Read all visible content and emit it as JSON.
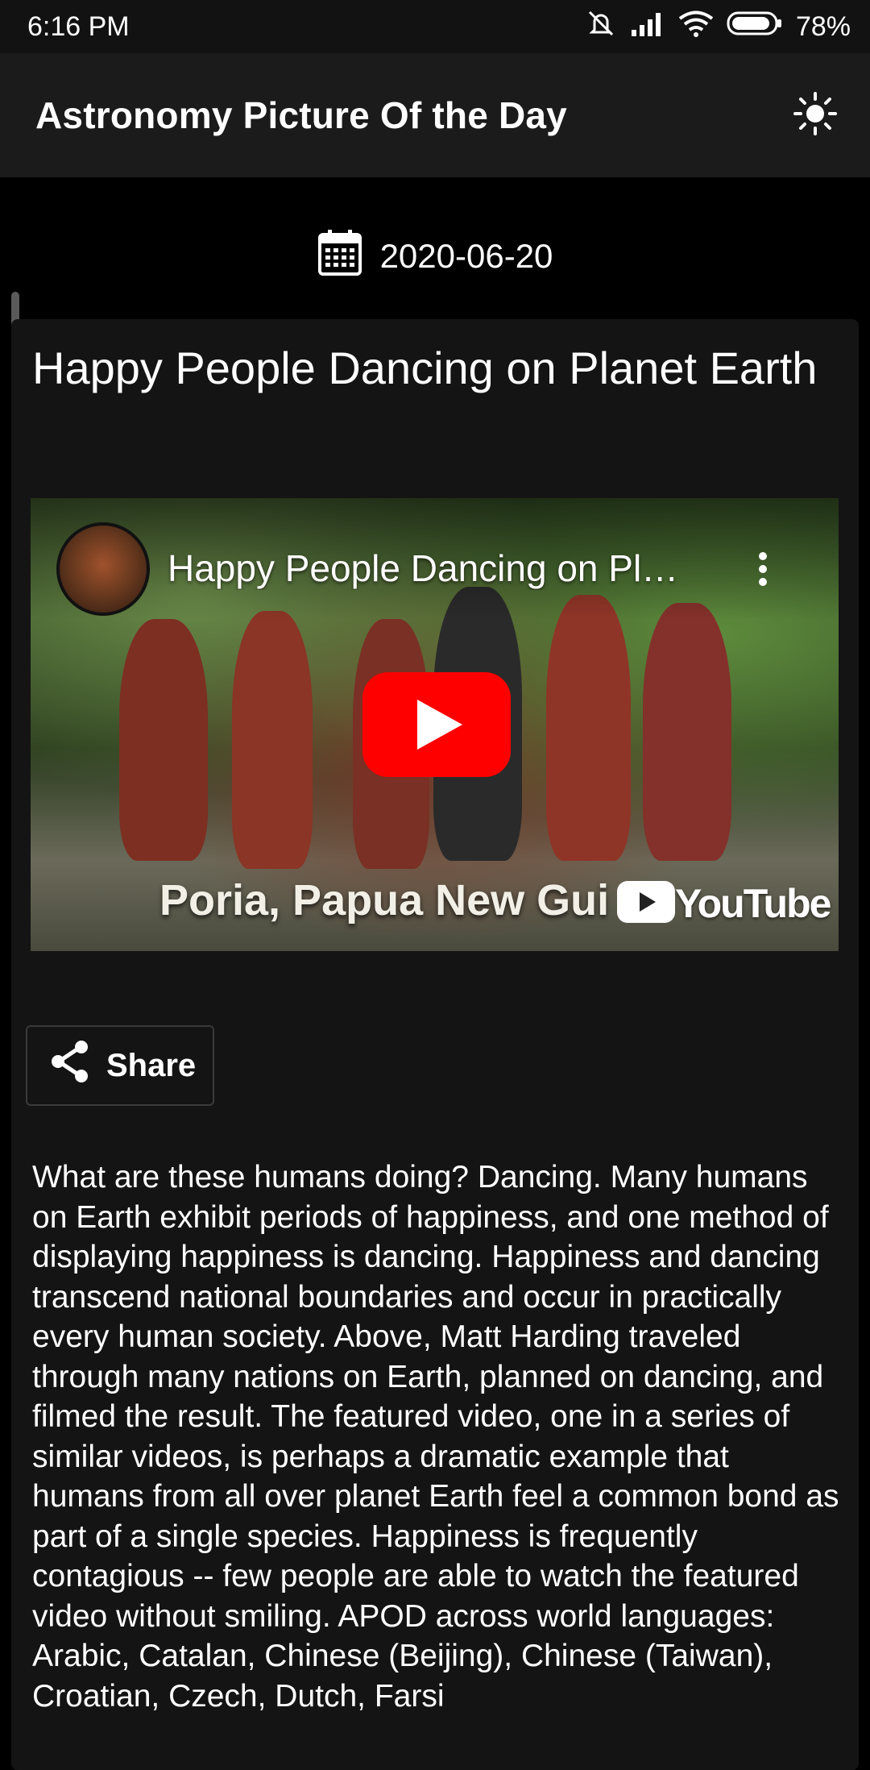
{
  "status_bar": {
    "time": "6:16 PM",
    "battery": "78%",
    "icons": [
      "mute-icon",
      "signal-icon",
      "wifi-icon",
      "battery-icon"
    ]
  },
  "app_bar": {
    "title": "Astronomy Picture Of the Day",
    "theme_toggle_icon": "sun-icon"
  },
  "date": {
    "icon": "calendar-icon",
    "value": "2020-06-20"
  },
  "post": {
    "title": "Happy People Dancing on Planet Earth",
    "video": {
      "title": "Happy People Dancing on Pl…",
      "caption": "Poria, Papua New Gui",
      "provider": "YouTube",
      "play_icon": "youtube-play-icon",
      "menu_icon": "more-vertical-icon"
    },
    "share_label": "Share",
    "description": "What are these humans doing?  Dancing.  Many humans on Earth exhibit periods of happiness, and one method of displaying happiness is dancing. Happiness and dancing transcend national boundaries and occur in practically every human society. Above, Matt Harding traveled through many nations on Earth, planned on dancing, and filmed the result.  The featured video, one in a series of similar videos, is perhaps a dramatic example that humans from all over planet Earth feel a common bond as part of a single species. Happiness is frequently contagious -- few people are able to watch the featured video without smiling.   APOD across world languages: Arabic, Catalan, Chinese (Beijing), Chinese (Taiwan), Croatian, Czech, Dutch, Farsi"
  },
  "colors": {
    "background": "#000000",
    "app_bar": "#1b1b1b",
    "card": "#141414",
    "youtube_red": "#ff0000"
  }
}
